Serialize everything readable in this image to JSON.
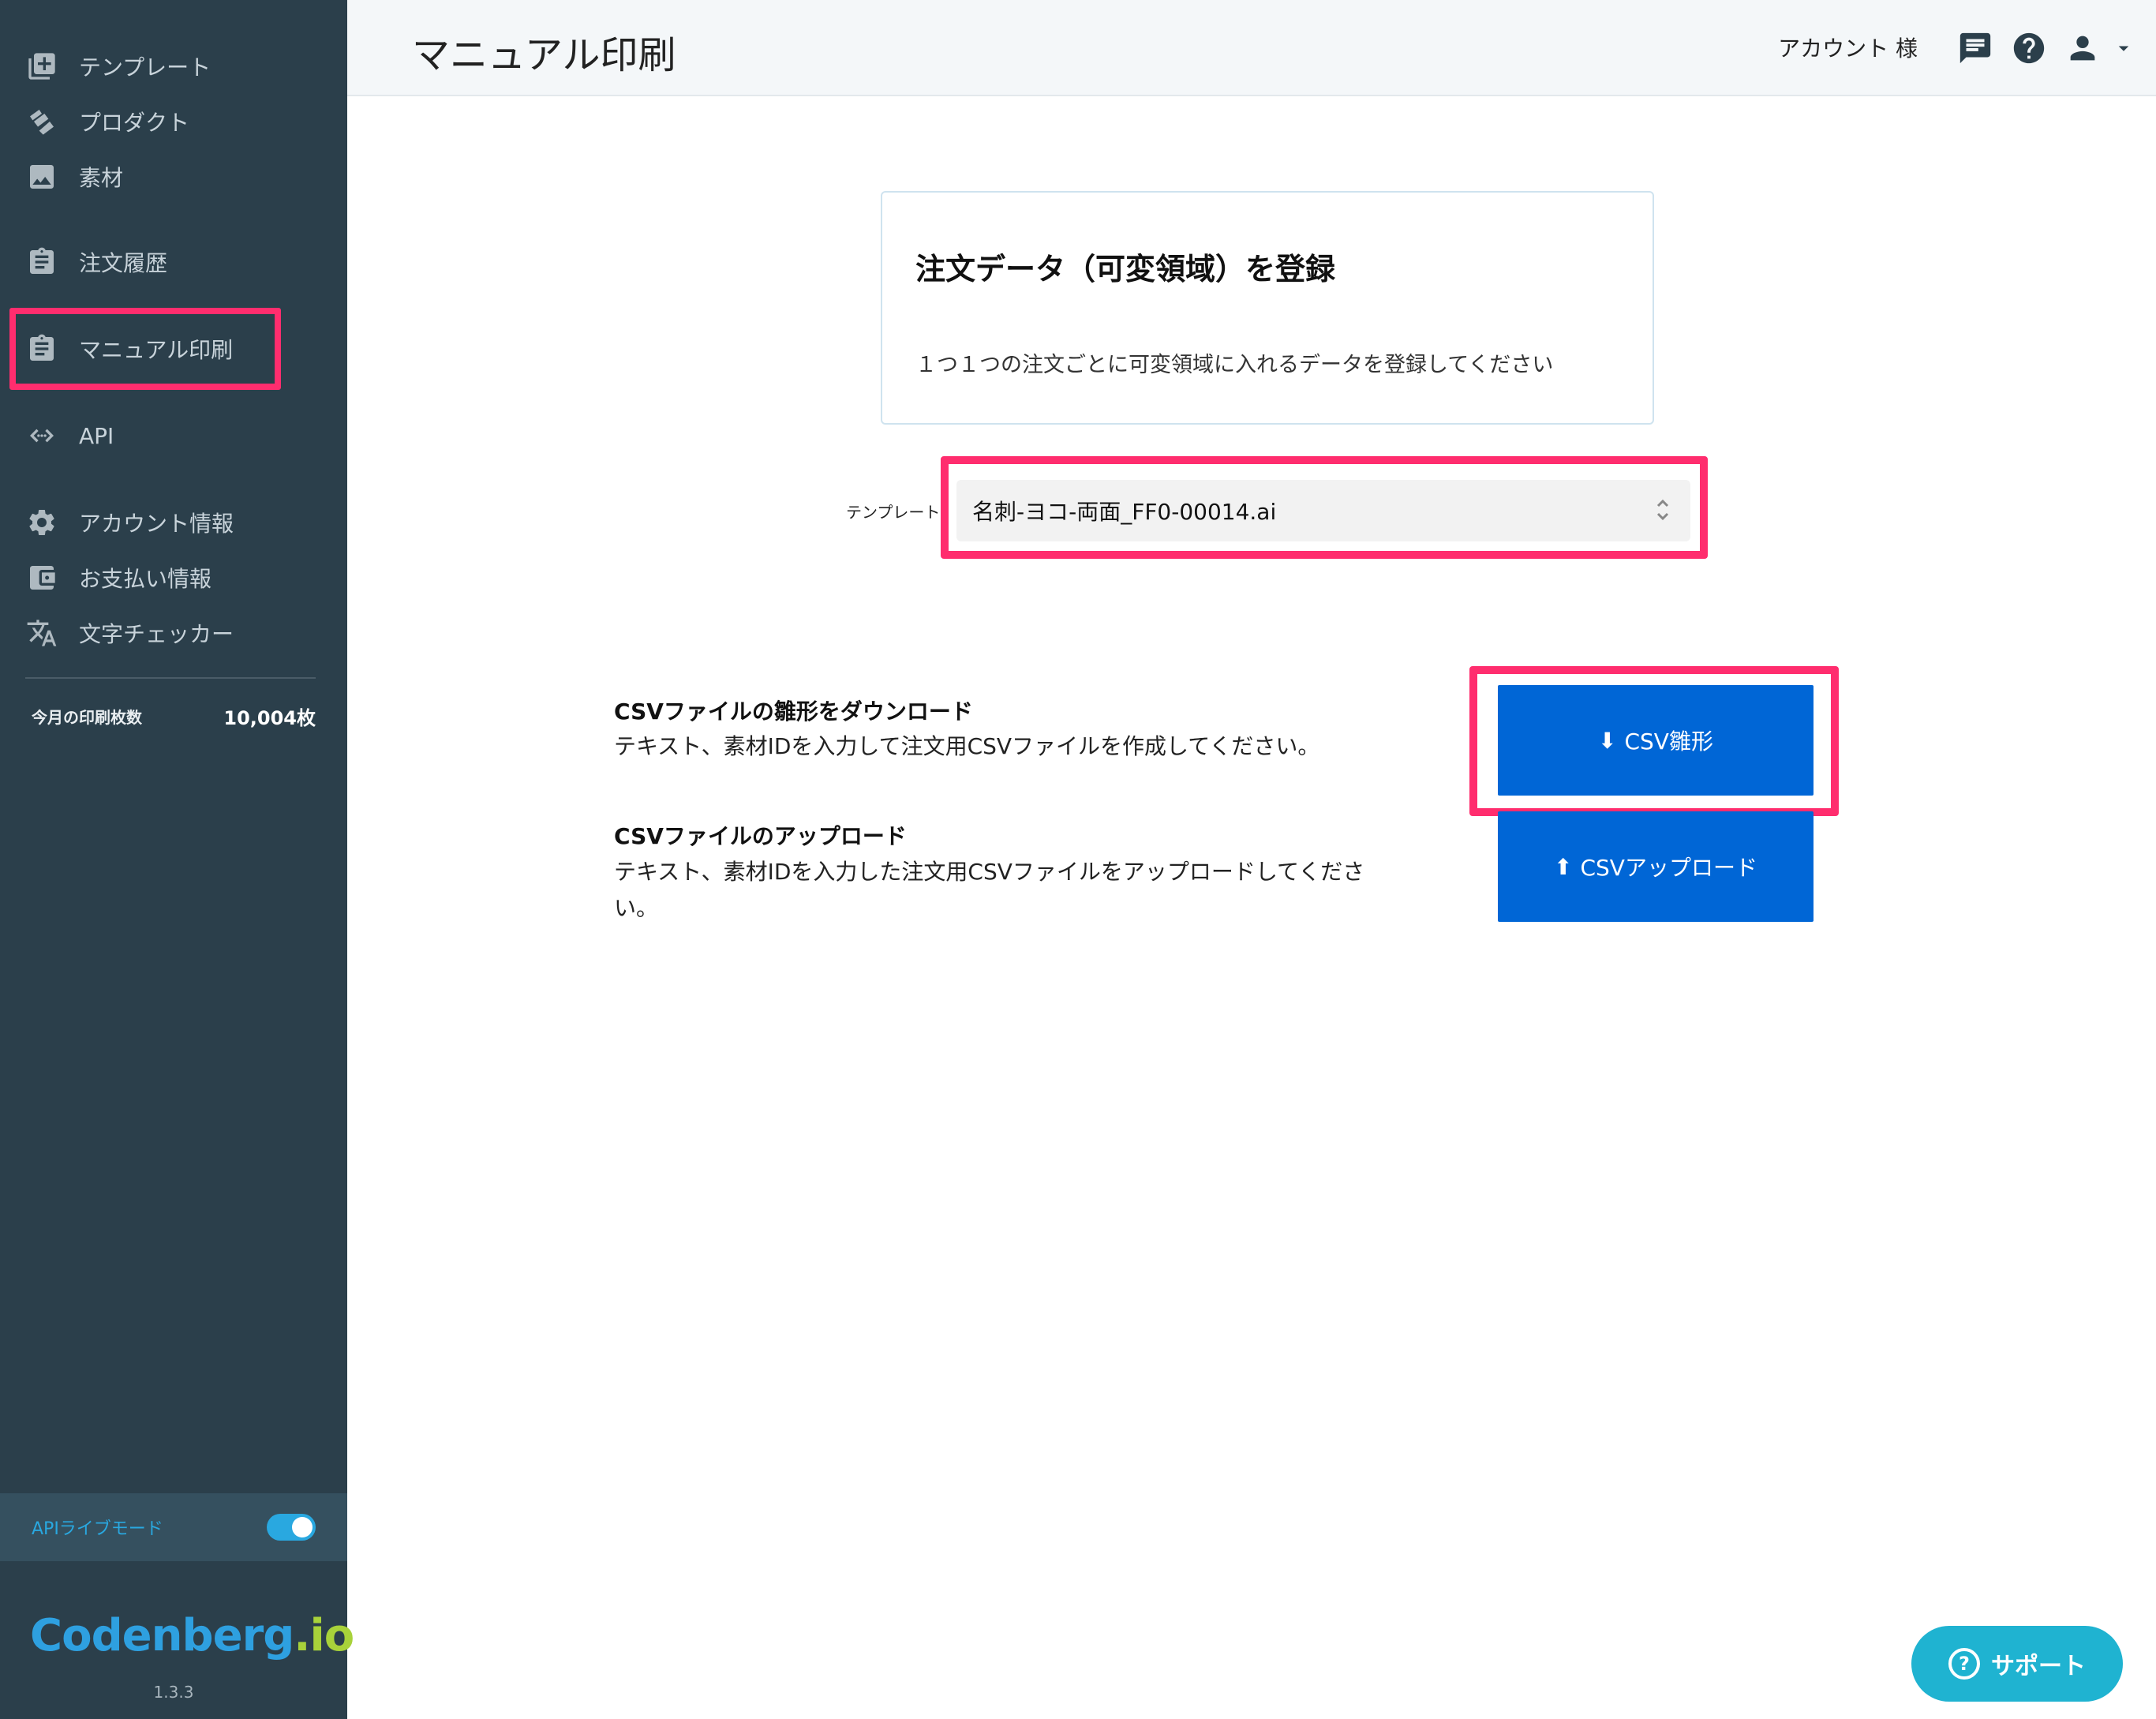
{
  "sidebar": {
    "items": [
      {
        "label": "テンプレート",
        "icon": "template-add-icon"
      },
      {
        "label": "プロダクト",
        "icon": "cards-icon"
      },
      {
        "label": "素材",
        "icon": "image-icon"
      },
      {
        "label": "注文履歴",
        "icon": "clipboard-icon"
      },
      {
        "label": "マニュアル印刷",
        "icon": "clipboard-icon"
      },
      {
        "label": "API",
        "icon": "code-icon"
      },
      {
        "label": "アカウント情報",
        "icon": "gear-icon"
      },
      {
        "label": "お支払い情報",
        "icon": "wallet-icon"
      },
      {
        "label": "文字チェッカー",
        "icon": "translate-icon"
      }
    ],
    "stat_label": "今月の印刷枚数",
    "stat_value": "10,004枚",
    "live_mode_label": "APIライブモード",
    "live_mode_on": true,
    "logo_main": "Codenberg",
    "logo_suffix": ".io",
    "version": "1.3.3"
  },
  "header": {
    "title": "マニュアル印刷",
    "account": "アカウント 様"
  },
  "card": {
    "title": "注文データ（可変領域）を登録",
    "description": "１つ１つの注文ごとに可変領域に入れるデータを登録してください"
  },
  "template_select": {
    "label": "テンプレート",
    "value": "名刺-ヨコ-両面_FF0-00014.ai"
  },
  "download": {
    "title": "CSVファイルの雛形をダウンロード",
    "description": "テキスト、素材IDを入力して注文用CSVファイルを作成してください。",
    "button_label": "CSV雛形"
  },
  "upload": {
    "title": "CSVファイルのアップロード",
    "description": "テキスト、素材IDを入力した注文用CSVファイルをアップロードしてください。",
    "button_label": "CSVアップロード"
  },
  "support": {
    "label": "サポート"
  },
  "colors": {
    "sidebar_bg": "#2b3f4b",
    "accent_blue": "#0066d6",
    "highlight": "#ff2d6e",
    "support": "#1fb3d1"
  }
}
